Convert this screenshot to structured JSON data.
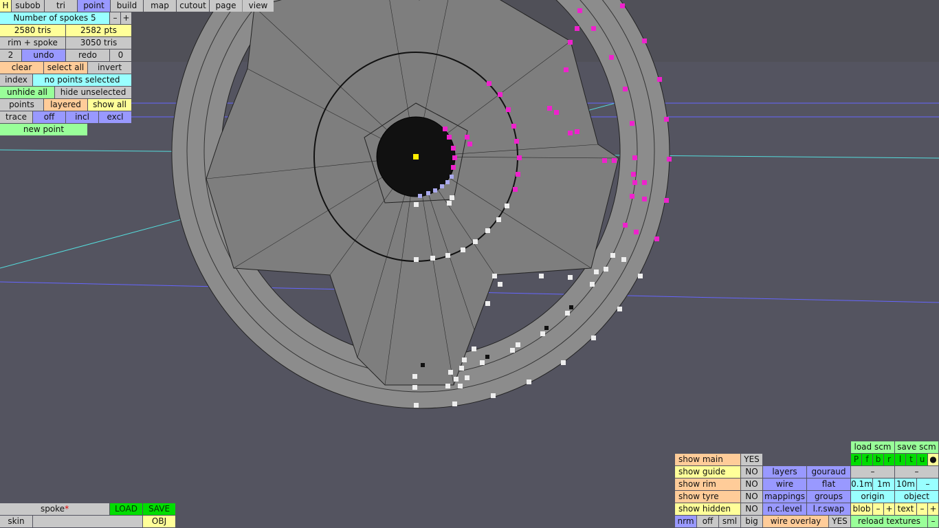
{
  "toolbar": {
    "h": "H",
    "subob": "subob",
    "tri": "tri",
    "point": "point",
    "build": "build",
    "map": "map",
    "cutout": "cutout",
    "page": "page",
    "view": "view"
  },
  "left": {
    "num_spokes": "Number of spokes 5",
    "minus": "–",
    "plus": "+",
    "tris": "2580 tris",
    "pts": "2582 pts",
    "rim_spoke": "rim + spoke",
    "tris2": "3050 tris",
    "undo_count": "2",
    "undo": "undo",
    "redo": "redo",
    "redo_count": "0",
    "clear": "clear",
    "select_all": "select all",
    "invert": "invert",
    "index": "index",
    "no_points": "no points selected",
    "unhide_all": "unhide all",
    "hide_unselected": "hide unselected",
    "points": "points",
    "layered": "layered",
    "show_all": "show all",
    "trace": "trace",
    "off": "off",
    "incl": "incl",
    "excl": "excl",
    "new_point": "new point"
  },
  "bottom_left": {
    "name": "spoke",
    "modified_mark": "*",
    "load": "LOAD",
    "save": "SAVE",
    "skin": "skin",
    "obj": "OBJ"
  },
  "bottom_right": {
    "show_main": "show main",
    "show_main_val": "YES",
    "show_guide": "show guide",
    "show_guide_val": "NO",
    "show_rim": "show rim",
    "show_rim_val": "NO",
    "show_tyre": "show tyre",
    "show_tyre_val": "NO",
    "show_hidden": "show hidden",
    "show_hidden_val": "NO",
    "layers": "layers",
    "gouraud": "gouraud",
    "wire": "wire",
    "flat": "flat",
    "mappings": "mappings",
    "groups": "groups",
    "nc_level": "n.c.level",
    "lr_swap": "l.r.swap",
    "nrm": "nrm",
    "off": "off",
    "sml": "sml",
    "big": "big",
    "wire_overlay": "wire overlay",
    "wire_overlay_val": "YES",
    "load_scm": "load scm",
    "save_scm": "save scm",
    "views": [
      "P",
      "f",
      "b",
      "r",
      "l",
      "t",
      "u"
    ],
    "dot": "●",
    "dash1": "–",
    "dash2": "–",
    "scale_01": "0.1m",
    "scale_1": "1m",
    "scale_10": "10m",
    "scale_minus": "–",
    "origin": "origin",
    "object": "object",
    "blob": "blob",
    "blob_minus": "–",
    "blob_plus": "+",
    "text": "text",
    "text_minus": "–",
    "text_plus": "+",
    "reload_textures": "reload textures",
    "reload_minus": "–"
  }
}
